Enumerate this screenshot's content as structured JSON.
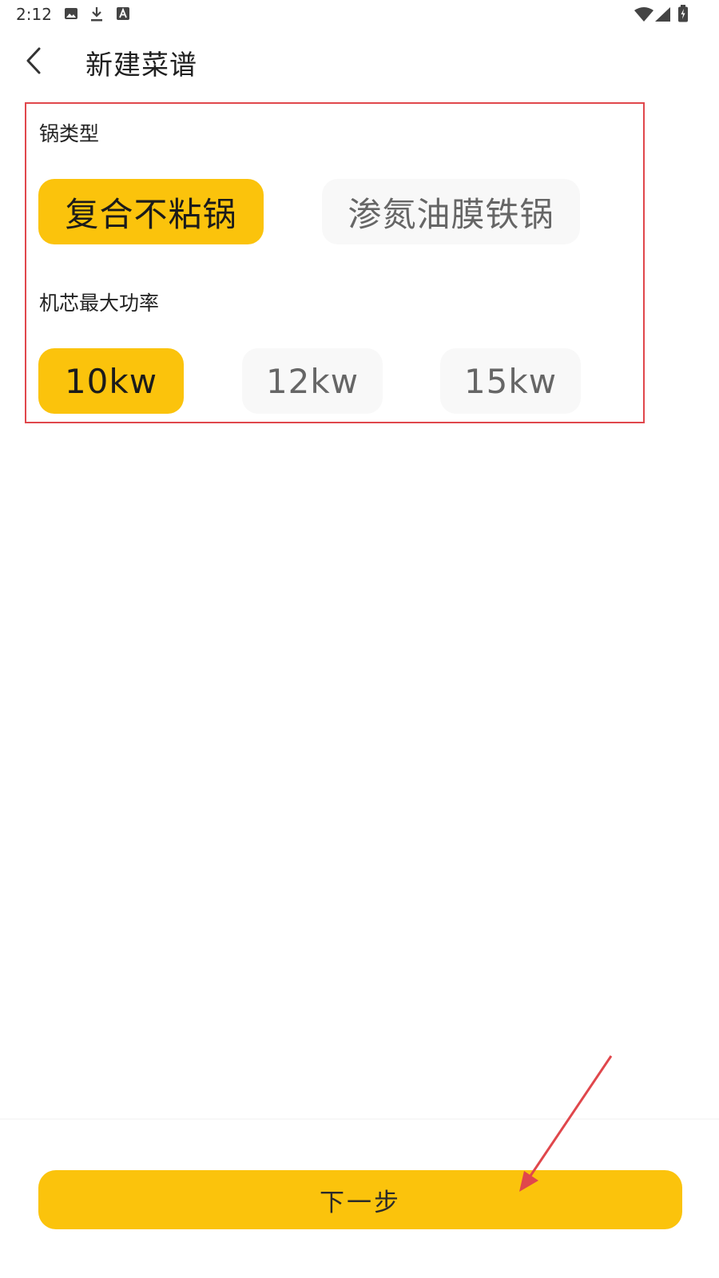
{
  "status_bar": {
    "time": "2:12",
    "left_icons": [
      "image-icon",
      "download-icon",
      "text-a-icon"
    ],
    "right_icons": [
      "wifi-icon",
      "cell-signal-icon",
      "battery-charging-icon"
    ]
  },
  "app_bar": {
    "back_icon": "chevron-left-icon",
    "title": "新建菜谱"
  },
  "form": {
    "pot_type": {
      "label": "锅类型",
      "options": [
        {
          "label": "复合不粘锅",
          "selected": true
        },
        {
          "label": "渗氮油膜铁锅",
          "selected": false
        }
      ]
    },
    "max_power": {
      "label": "机芯最大功率",
      "options": [
        {
          "label": "10kw",
          "selected": true
        },
        {
          "label": "12kw",
          "selected": false
        },
        {
          "label": "15kw",
          "selected": false
        }
      ]
    }
  },
  "footer": {
    "next_label": "下一步"
  },
  "colors": {
    "accent": "#fbc30c",
    "unselected_bg": "#f8f8f8",
    "annotation": "#e0474c"
  }
}
